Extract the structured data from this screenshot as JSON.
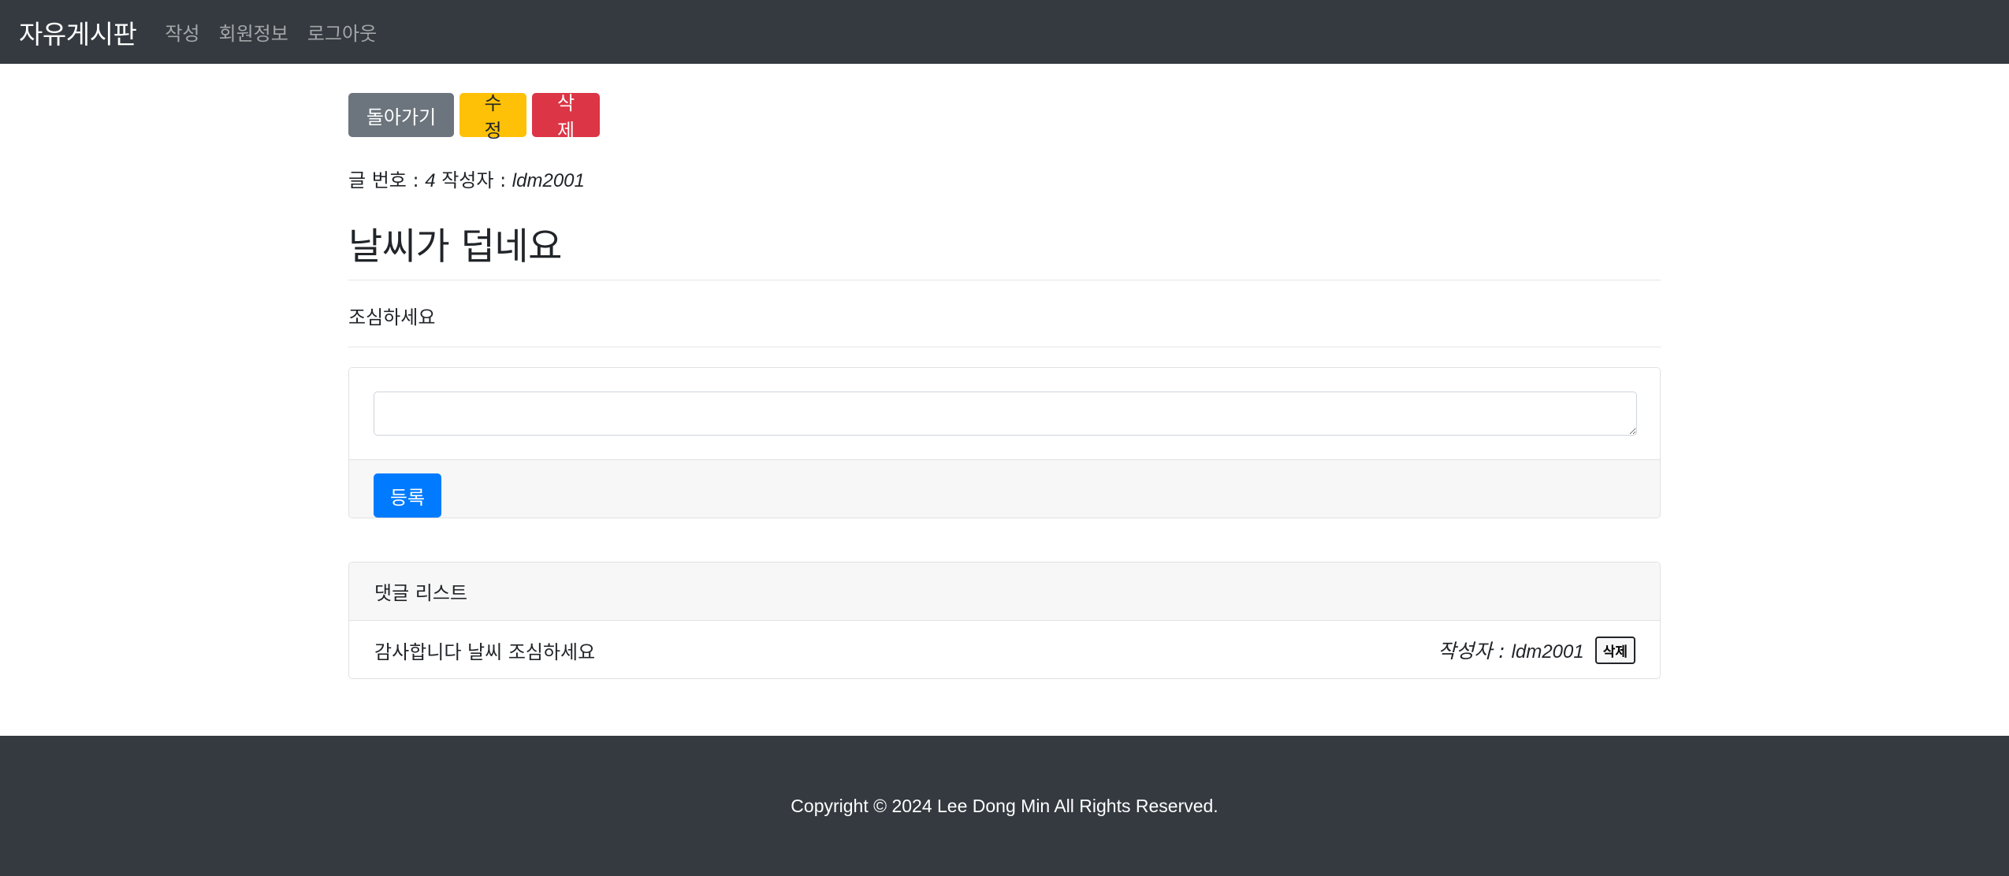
{
  "navbar": {
    "brand": "자유게시판",
    "links": [
      "작성",
      "회원정보",
      "로그아웃"
    ]
  },
  "actions": {
    "back_label": "돌아가기",
    "edit_label": "수정",
    "delete_label": "삭제"
  },
  "post": {
    "number_label": "글 번호 : ",
    "number": "4",
    "author_label": " 작성자 : ",
    "author": "ldm2001",
    "title": "날씨가 덥네요",
    "content": "조심하세요"
  },
  "comment_form": {
    "textarea_value": "",
    "textarea_placeholder": "",
    "submit_label": "등록"
  },
  "comments": {
    "header": "댓글 리스트",
    "items": [
      {
        "text": "감사합니다 날씨 조심하세요",
        "author_label": "작성자 : ",
        "author": "ldm2001",
        "delete_label": "삭제"
      }
    ]
  },
  "footer": {
    "copyright": "Copyright © 2024 Lee Dong Min All Rights Reserved."
  },
  "colors": {
    "navbar_bg": "#343a40",
    "primary": "#007bff",
    "secondary": "#6c757d",
    "warning": "#ffc107",
    "danger": "#dc3545"
  }
}
